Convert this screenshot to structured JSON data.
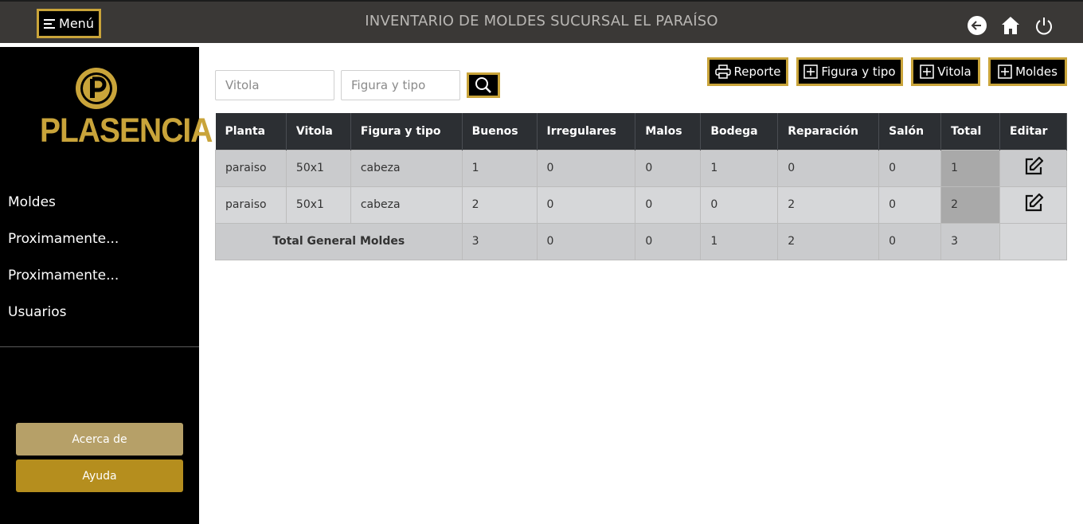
{
  "topbar": {
    "menu_label": "Menú",
    "title": "INVENTARIO DE MOLDES SUCURSAL EL PARAÍSO"
  },
  "sidebar": {
    "logo_text": "PLASENCIA",
    "items": [
      {
        "label": "Moldes"
      },
      {
        "label": "Proximamente..."
      },
      {
        "label": "Proximamente..."
      },
      {
        "label": "Usuarios"
      }
    ],
    "about_label": "Acerca de",
    "help_label": "Ayuda"
  },
  "search": {
    "vitola_placeholder": "Vitola",
    "figura_placeholder": "Figura y tipo"
  },
  "actions": {
    "reporte": "Reporte",
    "figura": "Figura y tipo",
    "vitola": "Vitola",
    "moldes": "Moldes"
  },
  "table": {
    "headers": [
      "Planta",
      "Vitola",
      "Figura y tipo",
      "Buenos",
      "Irregulares",
      "Malos",
      "Bodega",
      "Reparación",
      "Salón",
      "Total",
      "Editar"
    ],
    "rows": [
      {
        "planta": "paraiso",
        "vitola": "50x1",
        "figura": "cabeza",
        "buenos": "1",
        "irregulares": "0",
        "malos": "0",
        "bodega": "1",
        "reparacion": "0",
        "salon": "0",
        "total": "1"
      },
      {
        "planta": "paraiso",
        "vitola": "50x1",
        "figura": "cabeza",
        "buenos": "2",
        "irregulares": "0",
        "malos": "0",
        "bodega": "0",
        "reparacion": "2",
        "salon": "0",
        "total": "2"
      }
    ],
    "footer": {
      "label": "Total General Moldes",
      "buenos": "3",
      "irregulares": "0",
      "malos": "0",
      "bodega": "1",
      "reparacion": "2",
      "salon": "0",
      "total": "3"
    }
  },
  "colors": {
    "accent_gold": "#c9a43a",
    "topbar": "#3a3836",
    "sidebar": "#000000",
    "table_header": "#2c2f33"
  }
}
